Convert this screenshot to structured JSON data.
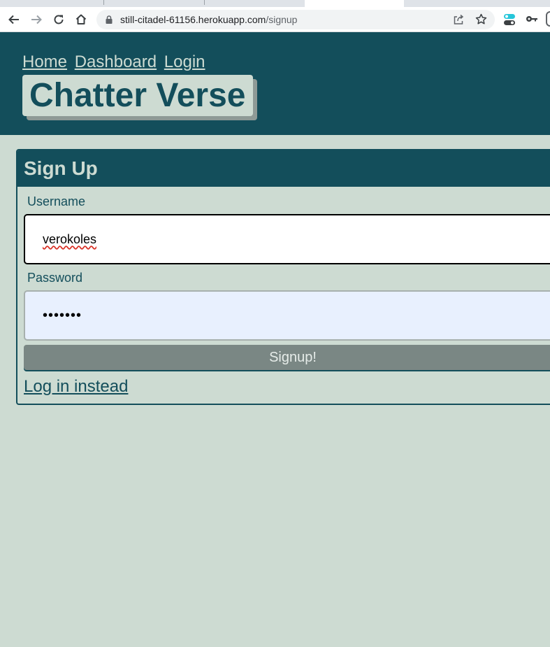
{
  "browser": {
    "url_host": "still-citadel-61156.herokuapp.com",
    "url_path": "/signup"
  },
  "site": {
    "nav": [
      "Home",
      "Dashboard",
      "Login"
    ],
    "brand": "Chatter Verse"
  },
  "signup_form": {
    "title": "Sign Up",
    "username_label": "Username",
    "username_value": "verokoles",
    "password_label": "Password",
    "password_value": "•••••••",
    "submit_label": "Signup!",
    "alt_link": "Log in instead"
  },
  "colors": {
    "primary": "#134e5b",
    "background": "#cddbd2",
    "button": "#7a8784",
    "autofill": "#e8f0fe"
  },
  "icons": [
    "back-arrow-icon",
    "forward-arrow-icon",
    "reload-icon",
    "home-icon",
    "lock-icon",
    "share-icon",
    "star-icon",
    "extension-icon",
    "key-icon"
  ]
}
